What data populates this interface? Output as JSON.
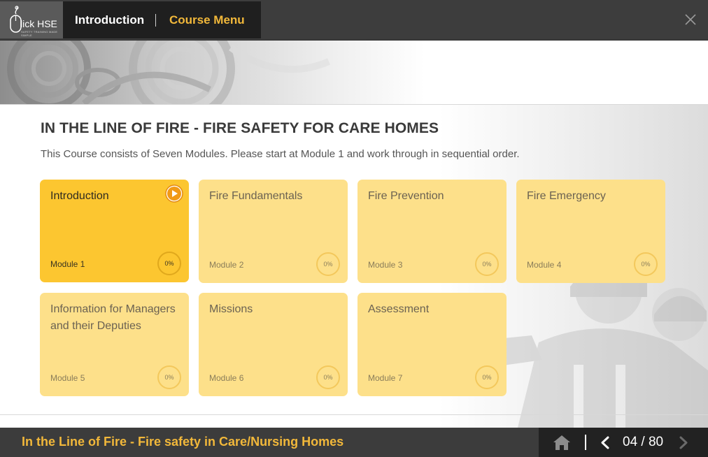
{
  "header": {
    "logo_text": "lick HSE",
    "logo_subtext": "SAFETY TRAINING MADE SIMPLE",
    "tabs": [
      {
        "label": "Introduction"
      },
      {
        "label": "Course Menu"
      }
    ],
    "close_icon": "close-icon"
  },
  "main": {
    "title": "IN THE LINE OF FIRE - FIRE SAFETY FOR CARE HOMES",
    "subtitle": "This Course consists of Seven Modules. Please start at Module 1 and work through in sequential order.",
    "modules": [
      {
        "title": "Introduction",
        "module": "Module 1",
        "progress": "0%",
        "active": true
      },
      {
        "title": "Fire Fundamentals",
        "module": "Module 2",
        "progress": "0%",
        "active": false
      },
      {
        "title": "Fire Prevention",
        "module": "Module 3",
        "progress": "0%",
        "active": false
      },
      {
        "title": "Fire Emergency",
        "module": "Module 4",
        "progress": "0%",
        "active": false
      },
      {
        "title": "Information for Managers and their Deputies",
        "module": "Module 5",
        "progress": "0%",
        "active": false
      },
      {
        "title": "Missions",
        "module": "Module 6",
        "progress": "0%",
        "active": false
      },
      {
        "title": "Assessment",
        "module": "Module 7",
        "progress": "0%",
        "active": false
      }
    ]
  },
  "footer": {
    "course_title": "In the Line of Fire - Fire safety in Care/Nursing Homes",
    "page_counter": "04 / 80"
  },
  "colors": {
    "accent": "#f2b83a",
    "card_active": "#fcc630",
    "card_inactive": "#fde08a",
    "header_bg": "#3d3d3d",
    "footer_bg": "#3c3c3c"
  }
}
